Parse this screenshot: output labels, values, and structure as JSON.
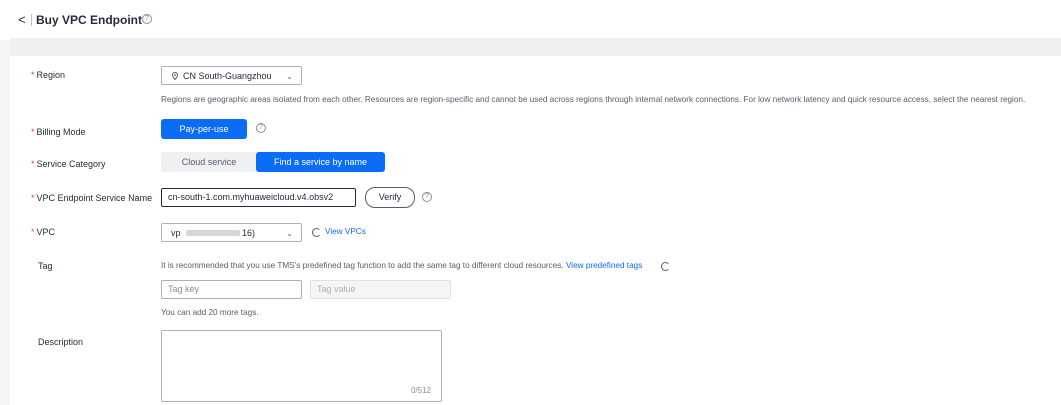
{
  "header": {
    "back_glyph": "<",
    "title": "Buy VPC Endpoint",
    "help_glyph": "?"
  },
  "form": {
    "region": {
      "label": "Region",
      "value": "CN South-Guangzhou",
      "hint": "Regions are geographic areas isolated from each other. Resources are region-specific and cannot be used across regions through internal network connections. For low network latency and quick resource access, select the nearest region."
    },
    "billing_mode": {
      "label": "Billing Mode",
      "option": "Pay-per-use"
    },
    "service_category": {
      "label": "Service Category",
      "options": [
        "Cloud service",
        "Find a service by name"
      ],
      "selected": "Find a service by name"
    },
    "service_name": {
      "label": "VPC Endpoint Service Name",
      "value": "cn-south-1.com.myhuaweicloud.v4.obsv2",
      "verify_label": "Verify"
    },
    "vpc": {
      "label": "VPC",
      "value_prefix": "vp",
      "value_suffix": "16)",
      "view_link": "View VPCs"
    },
    "tag": {
      "label": "Tag",
      "hint": "It is recommended that you use TMS's predefined tag function to add the same tag to different cloud resources.",
      "hint_link": "View predefined tags",
      "key_placeholder": "Tag key",
      "value_placeholder": "Tag value",
      "remaining": "You can add 20 more tags."
    },
    "description": {
      "label": "Description",
      "counter": "0/512"
    }
  },
  "colors": {
    "accent": "#0a6cf7",
    "required": "#e54545"
  },
  "icons": {
    "back": "chevron-left-icon",
    "help": "question-circle-icon",
    "location": "location-pin-icon",
    "dropdown": "chevron-down-icon",
    "refresh": "refresh-icon"
  }
}
